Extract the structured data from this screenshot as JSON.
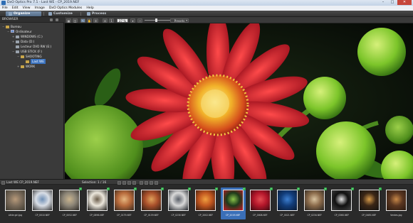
{
  "window": {
    "title": "DxO Optics Pro 7.1 - Last WE - CP_2019.NEF",
    "minimize": "–",
    "maximize": "□",
    "close": "✕"
  },
  "menu": [
    "File",
    "Edit",
    "View",
    "Image",
    "DxO Optics Modules",
    "Help"
  ],
  "tabs": {
    "organize": "Organize",
    "customize": "Customize",
    "process": "Process"
  },
  "left_panel": {
    "header": "BROWSER"
  },
  "tree": [
    {
      "label": "Bureau",
      "level": 0,
      "kind": "folder",
      "expander": "−"
    },
    {
      "label": "Ordinateur",
      "level": 1,
      "kind": "pc",
      "expander": "−"
    },
    {
      "label": "WINDOWS (C:)",
      "level": 2,
      "kind": "drive",
      "expander": "+"
    },
    {
      "label": "Data (D:)",
      "level": 2,
      "kind": "drive",
      "expander": "+"
    },
    {
      "label": "Lecteur DVD RW (E:)",
      "level": 2,
      "kind": "drive",
      "expander": ""
    },
    {
      "label": "USB STICK (F:)",
      "level": 2,
      "kind": "drive",
      "expander": "−"
    },
    {
      "label": "SHOOTING",
      "level": 3,
      "kind": "folder",
      "expander": "−"
    },
    {
      "label": "Last WE",
      "level": 4,
      "kind": "folder",
      "expander": "",
      "selected": true
    },
    {
      "label": "WORK",
      "level": 3,
      "kind": "folder",
      "expander": "+"
    }
  ],
  "viewer_toolbar": {
    "zoom": "37 %",
    "presets": "Presets",
    "zoom_level_fraction": 0.45
  },
  "filmstrip_header": {
    "path": "Last WE  CP_2019.NEF",
    "selection": "Selection: 1 / 16"
  },
  "filmstrip": [
    {
      "name": "Little girl.jpg",
      "palette": [
        "#7a6b5a",
        "#b89a7a",
        "#3e3a30"
      ],
      "checked": false
    },
    {
      "name": "CP_0010.NEF",
      "palette": [
        "#d9dee6",
        "#6f8fb5",
        "#333"
      ],
      "checked": false
    },
    {
      "name": "CP_0052.NEF",
      "palette": [
        "#8c8577",
        "#c9b48e",
        "#2d2a26"
      ],
      "checked": true
    },
    {
      "name": "CP_0896.NEF",
      "palette": [
        "#ece7dc",
        "#6a5c4a",
        "#1e1c1a"
      ],
      "checked": true
    },
    {
      "name": "CP_0179.NEF",
      "palette": [
        "#b76a3b",
        "#e6b780",
        "#3a2a1e"
      ],
      "checked": true
    },
    {
      "name": "CP_0159.NEF",
      "palette": [
        "#a84f2a",
        "#e0a05a",
        "#2e1f15"
      ],
      "checked": true
    },
    {
      "name": "CP_0230.NEF",
      "palette": [
        "#d9d9d9",
        "#5a5f68",
        "#20242a"
      ],
      "checked": true
    },
    {
      "name": "CP_2002.NEF",
      "palette": [
        "#c0561f",
        "#f0a040",
        "#3a1a0e"
      ],
      "checked": true
    },
    {
      "name": "CP_2019.NEF",
      "palette": [
        "#1e3a1a",
        "#8bc34a",
        "#c2192b"
      ],
      "checked": true,
      "current": true
    },
    {
      "name": "CP_0008.NEF",
      "palette": [
        "#b3162a",
        "#e34b52",
        "#3b0a10"
      ],
      "checked": true
    },
    {
      "name": "CP_0021.NEF",
      "palette": [
        "#123d7a",
        "#3d7fd0",
        "#0a1a33"
      ],
      "checked": true
    },
    {
      "name": "CP_0234.NEF",
      "palette": [
        "#8a6a4a",
        "#d9c4a0",
        "#2a2520"
      ],
      "checked": true
    },
    {
      "name": "CP_0360.NEF",
      "palette": [
        "#101010",
        "#e5e5e5",
        "#444"
      ],
      "checked": true
    },
    {
      "name": "CP_0485.NEF",
      "palette": [
        "#3a2616",
        "#d79b4a",
        "#121212"
      ],
      "checked": true
    },
    {
      "name": "Ventes.jpg",
      "palette": [
        "#5a3620",
        "#c88848",
        "#2a1a10"
      ],
      "checked": false
    }
  ],
  "colors": {
    "accent": "#3a6fb8",
    "check": "#2fb04a"
  }
}
